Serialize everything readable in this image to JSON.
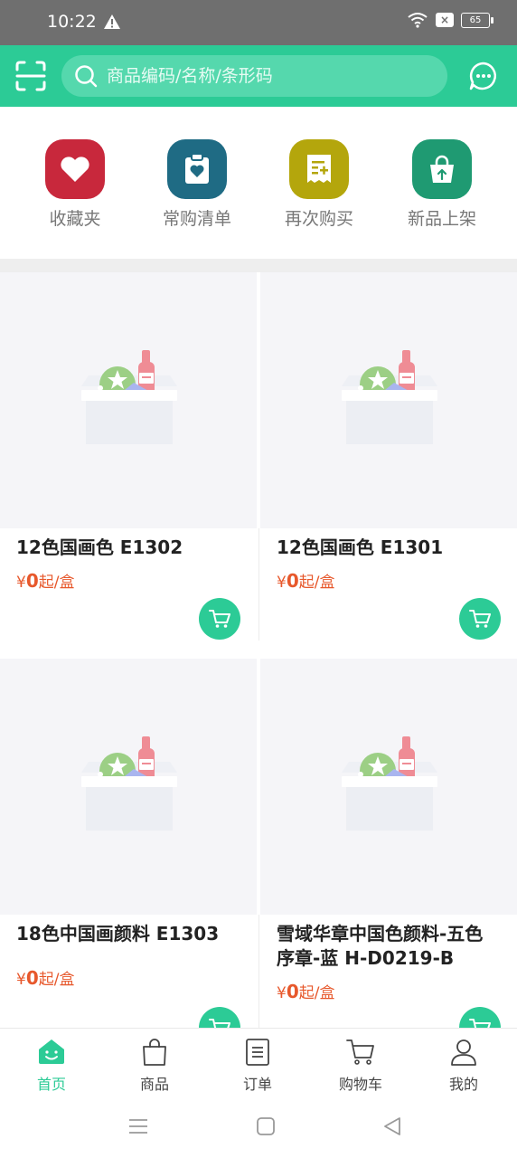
{
  "status_bar": {
    "time": "10:22",
    "battery": "65"
  },
  "search": {
    "placeholder": "商品编码/名称/条形码"
  },
  "quick_actions": [
    {
      "label": "收藏夹",
      "icon": "heart-icon",
      "color": "#c8283c"
    },
    {
      "label": "常购清单",
      "icon": "clipboard-heart-icon",
      "color": "#1f6b84"
    },
    {
      "label": "再次购买",
      "icon": "receipt-plus-icon",
      "color": "#b4a60c"
    },
    {
      "label": "新品上架",
      "icon": "shopping-bag-icon",
      "color": "#1f9a72"
    }
  ],
  "products": [
    {
      "name": "12色国画色 E1302",
      "price": "0",
      "currency": "¥",
      "unit": "起/盒"
    },
    {
      "name": "12色国画色 E1301",
      "price": "0",
      "currency": "¥",
      "unit": "起/盒"
    },
    {
      "name": "18色中国画颜料 E1303",
      "price": "0",
      "currency": "¥",
      "unit": "起/盒"
    },
    {
      "name": "雪域华章中国色颜料-五色序章-蓝 H-D0219-B",
      "price": "0",
      "currency": "¥",
      "unit": "起/盒"
    }
  ],
  "tabs": [
    {
      "label": "首页",
      "icon": "home-icon",
      "active": true
    },
    {
      "label": "商品",
      "icon": "bag-icon"
    },
    {
      "label": "订单",
      "icon": "order-list-icon"
    },
    {
      "label": "购物车",
      "icon": "cart-icon"
    },
    {
      "label": "我的",
      "icon": "user-icon"
    }
  ],
  "colors": {
    "accent": "#2ccb96",
    "price": "#e7582c"
  }
}
